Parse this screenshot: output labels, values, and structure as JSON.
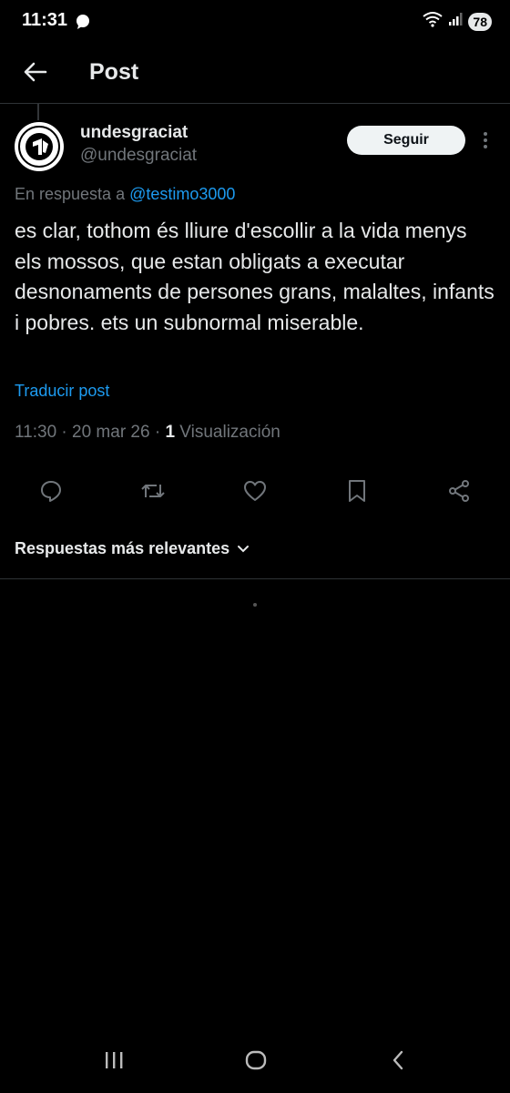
{
  "status_bar": {
    "time": "11:31",
    "battery": "78",
    "icons": [
      "chat-bubble-icon",
      "wifi-icon",
      "signal-icon",
      "battery-icon"
    ]
  },
  "header": {
    "title": "Post",
    "back_icon": "arrow-left-icon"
  },
  "post": {
    "author": {
      "display_name": "undesgraciat",
      "handle": "@undesgraciat"
    },
    "follow_label": "Seguir",
    "reply_prefix": "En respuesta a",
    "reply_mention": "@testimo3000",
    "text": "es clar, tothom és lliure d'escollir a la vida menys els mossos, que estan obligats a executar desnonaments de persones grans, malaltes, infants i pobres. ets un subnormal miserable.",
    "translate_label": "Traducir post",
    "timestamp": "11:30 · 20 mar 26 · ",
    "views_count": "1",
    "views_label": " Visualización"
  },
  "actions": [
    "reply-icon",
    "repost-icon",
    "like-icon",
    "bookmark-icon",
    "share-icon"
  ],
  "replies": {
    "sort_label": "Respuestas más relevantes"
  },
  "nav_bar": [
    "recents-icon",
    "home-icon",
    "back-icon"
  ],
  "colors": {
    "background": "#000000",
    "text_primary": "#e7e9ea",
    "text_secondary": "#71767b",
    "accent": "#1d9bf0",
    "divider": "#2f3336"
  }
}
